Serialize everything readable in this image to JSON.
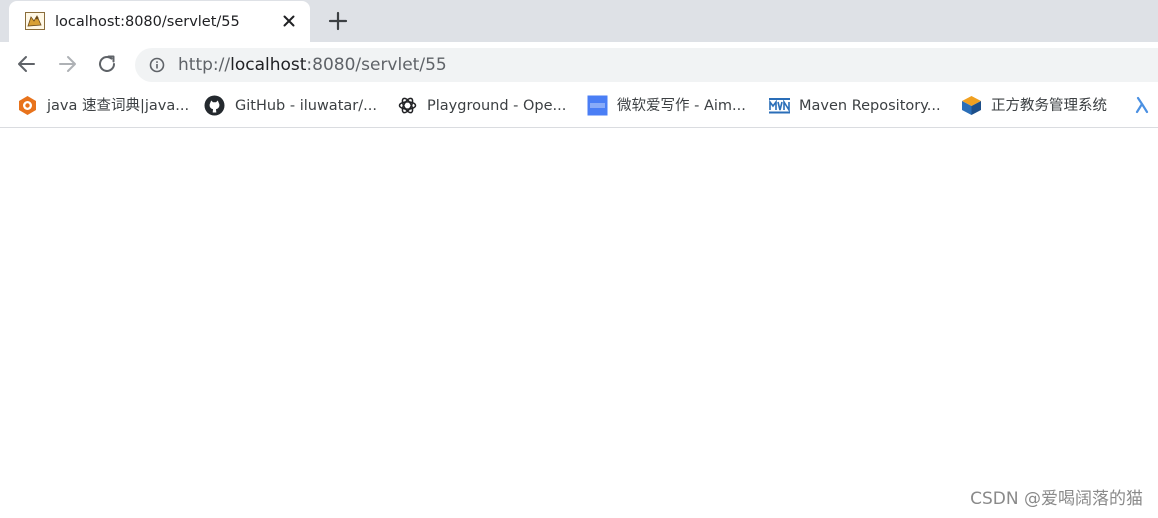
{
  "tab": {
    "title": "localhost:8080/servlet/55",
    "favicon": "tomcat-icon"
  },
  "toolbar": {
    "url_scheme": "http://",
    "url_host": "localhost",
    "url_rest": ":8080/servlet/55"
  },
  "bookmarks": [
    {
      "label": "java 速查词典|java...",
      "icon": "java-dictionary-icon",
      "color": "#e8731c"
    },
    {
      "label": "GitHub - iluwatar/...",
      "icon": "github-icon",
      "color": "#24292e"
    },
    {
      "label": "Playground - Ope...",
      "icon": "openai-icon",
      "color": "#202124"
    },
    {
      "label": "微软爱写作 - Aim...",
      "icon": "aim-icon",
      "color": "#4a7ef5"
    },
    {
      "label": "Maven Repository...",
      "icon": "maven-icon",
      "color": "#2a6eb8"
    },
    {
      "label": "正方教务管理系统",
      "icon": "zhengfang-icon",
      "color": "#f0a020"
    }
  ],
  "watermark": "CSDN @爱喝阔落的猫"
}
